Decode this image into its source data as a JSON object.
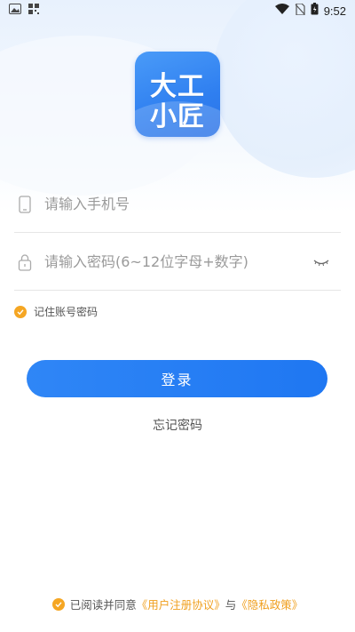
{
  "status_bar": {
    "time": "9:52",
    "left_icons": [
      "image-icon",
      "qr-icon"
    ],
    "right_icons": [
      "wifi-icon",
      "no-sim-icon",
      "battery-icon"
    ]
  },
  "logo": {
    "line1": "大工",
    "line2": "小匠",
    "color": "#2f7ff0"
  },
  "form": {
    "phone_placeholder": "请输入手机号",
    "password_placeholder": "请输入密码(6~12位字母+数字)",
    "remember_label": "记住账号密码",
    "remember_checked": true
  },
  "login_button": {
    "label": "登录",
    "color": "#1f77f2"
  },
  "forgot_password": "忘记密码",
  "agreement": {
    "checked": true,
    "prefix": "已阅读并同意",
    "user_agreement": "《用户注册协议》",
    "conjunction": "与",
    "privacy_policy": "《隐私政策》",
    "link_color": "#f0a020"
  },
  "colors": {
    "accent_orange": "#f5a623",
    "primary_blue": "#2f86f6"
  }
}
